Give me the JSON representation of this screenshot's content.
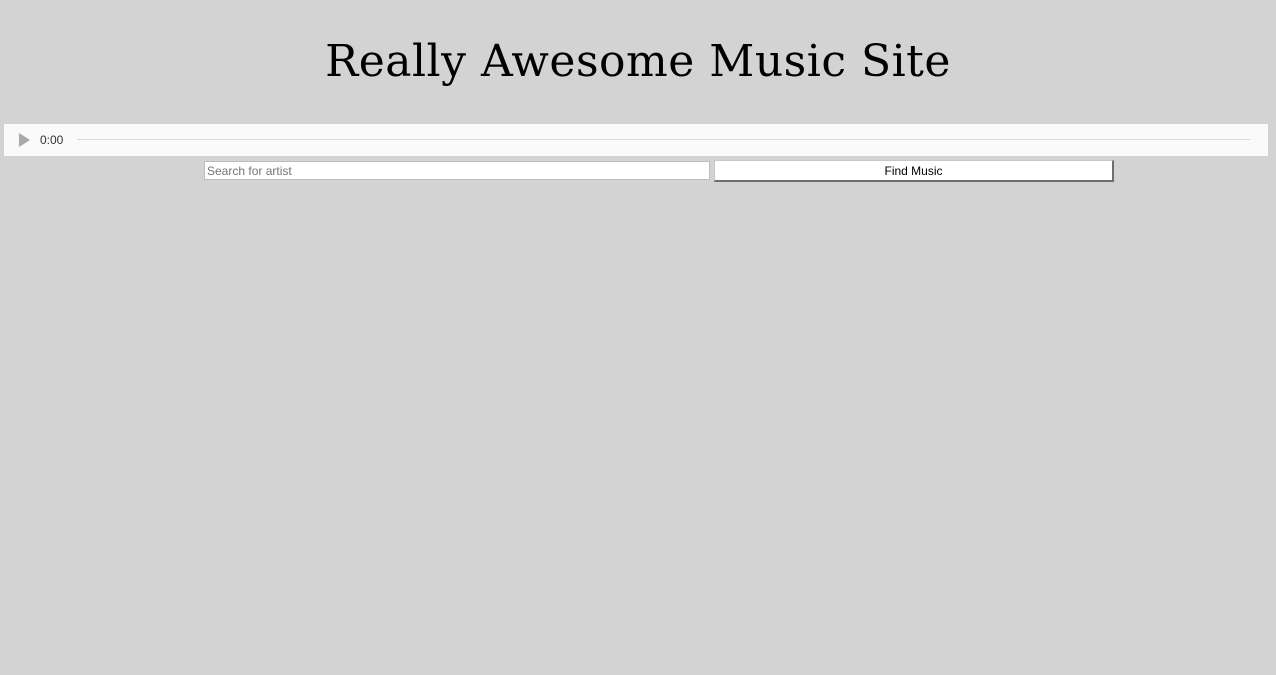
{
  "header": {
    "title": "Really Awesome Music Site"
  },
  "player": {
    "time": "0:00",
    "progress": 0,
    "play_icon": "play-icon"
  },
  "search": {
    "placeholder": "Search for artist",
    "value": "",
    "button_label": "Find Music"
  },
  "colors": {
    "page_background": "#d3d3d3",
    "player_background": "#fafafa"
  }
}
